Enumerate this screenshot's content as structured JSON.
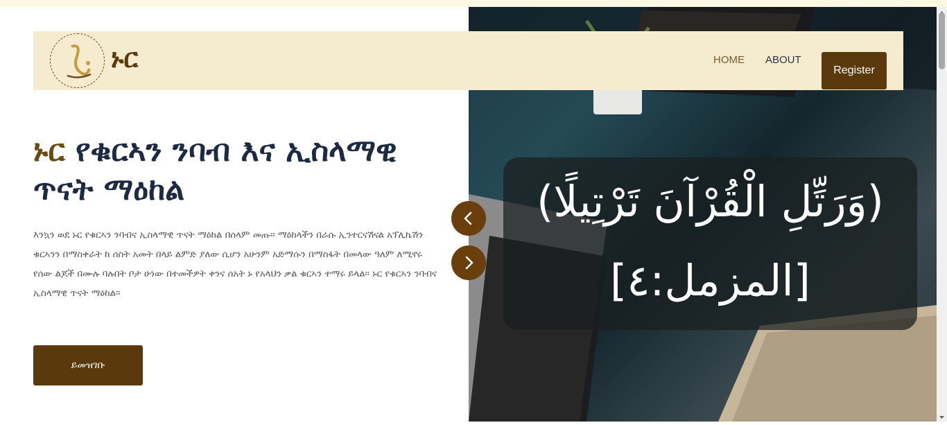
{
  "nav": {
    "brand": "ኑር",
    "home_label": "HOME",
    "about_label": "ABOUT",
    "register_label": "Register"
  },
  "hero": {
    "headline_accent": "ኑር",
    "headline_rest": " የቁርኣን ንባብ እና ኢስላማዊ ጥናት ማዕከል",
    "description": "እንኳን ወደ ኑር የቁርኣን ንባብና ኢስላማዊ ጥናት ማዕከል በሰላም መጡ። ማዕከላችን በራሱ ኢንተርናሽናል አፕሊኬሽን ቁርኣንን በማስቀራት ከ ሰስት አመት በላይ ልምድ ያለው ሲሆን አሁንም አድማሱን በማስፋት በመላው ዓለም ለሚኖሩ የሰው ልጆች በሙሉ ባሉበት ቦታ ሁነው በተመችዎት ቀንና ሰአት ኑ የአላህን ቃል ቁርኣን ተማሩ ይላል። ኑር የቁርኣን ንባብና ኢስላማዊ ጥናት ማዕከል።",
    "cta_label": "ይመዝገቡ"
  },
  "slider": {
    "quote_line1": "(وَرَتِّلِ الْقُرْآنَ تَرْتِيلًا)",
    "quote_line2": "[المزمل:٤]",
    "prev_icon": "chevron-left-icon",
    "next_icon": "chevron-right-icon"
  },
  "colors": {
    "brand_brown": "#5a3a0c",
    "nav_bg": "#f5ebce",
    "headline_navy": "#1d2a44",
    "arrow_bg": "#6b3f0c"
  }
}
